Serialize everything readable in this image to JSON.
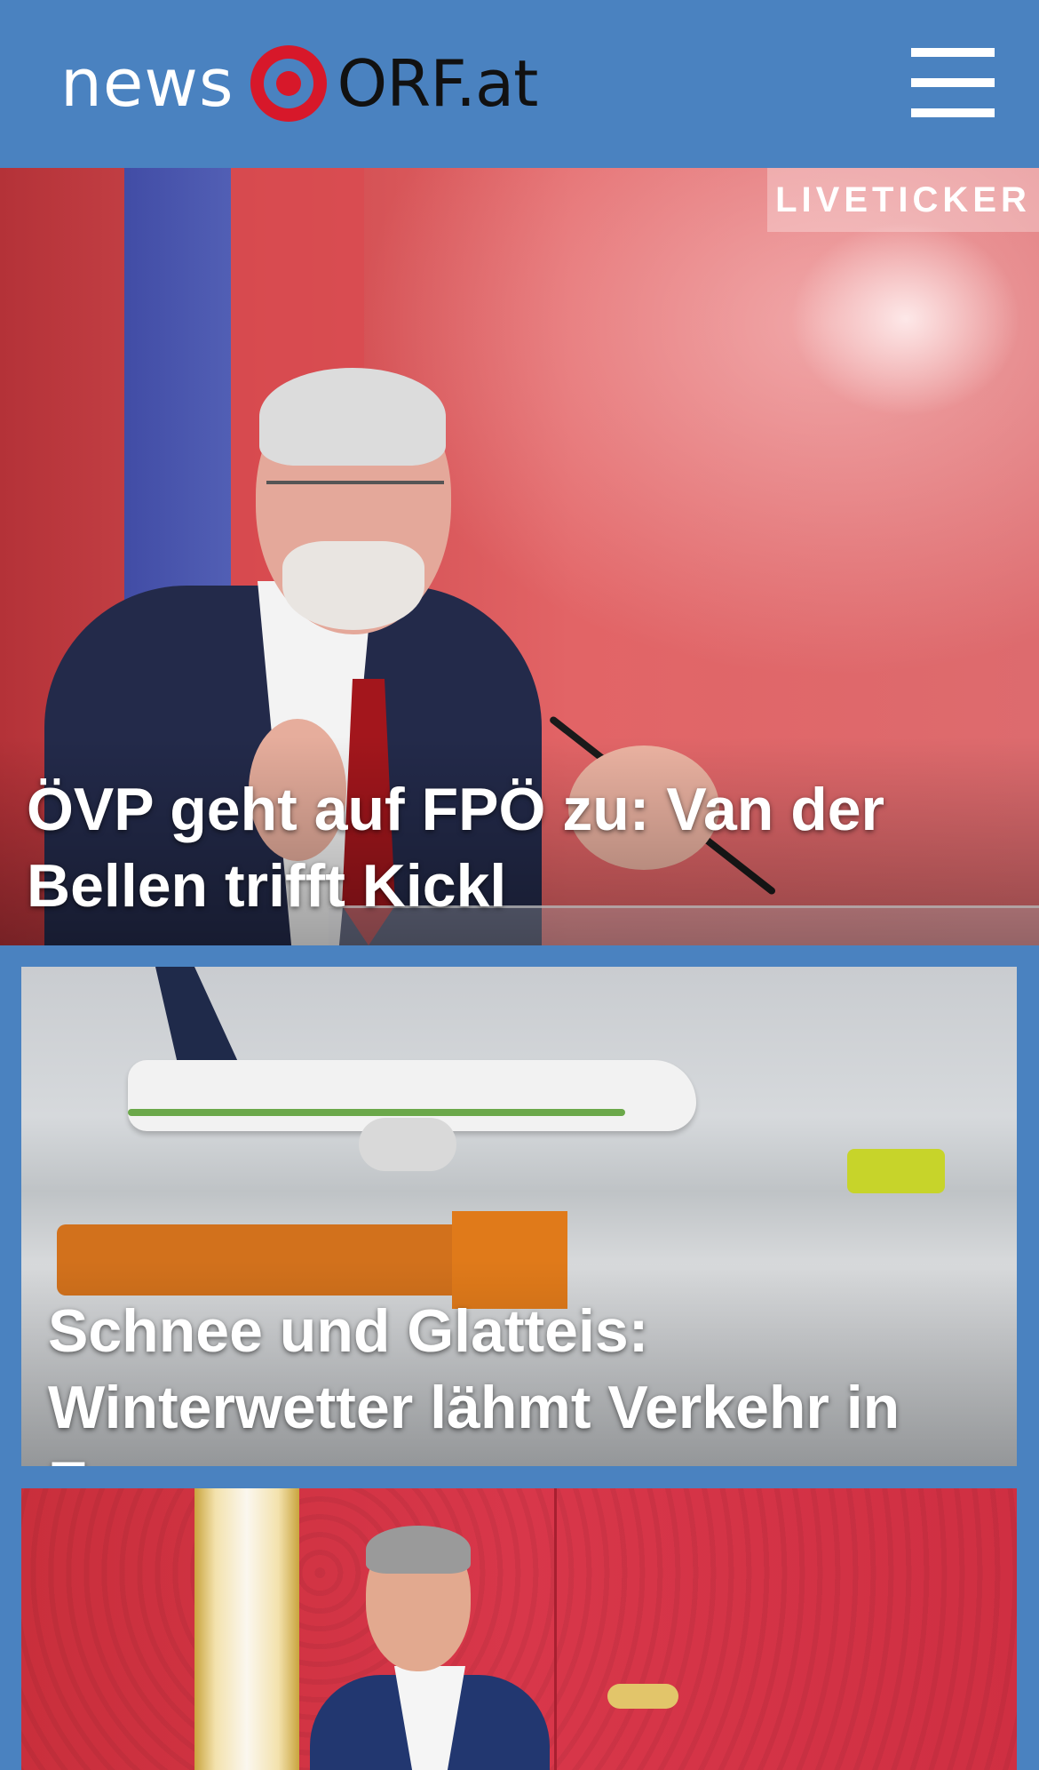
{
  "header": {
    "logo_news": "news",
    "logo_orf": "ORF.at",
    "menu_icon": "hamburger-menu-icon"
  },
  "colors": {
    "brand_blue": "#4a82c0",
    "brand_red": "#d7182a"
  },
  "stories": [
    {
      "badge": "LIVETICKER",
      "headline": "ÖVP geht auf FPÖ zu: Van der Bellen trifft Kickl"
    },
    {
      "headline": "Schnee und Glatteis: Winterwetter lähmt Verkehr in Europa"
    },
    {
      "headline": ""
    }
  ]
}
